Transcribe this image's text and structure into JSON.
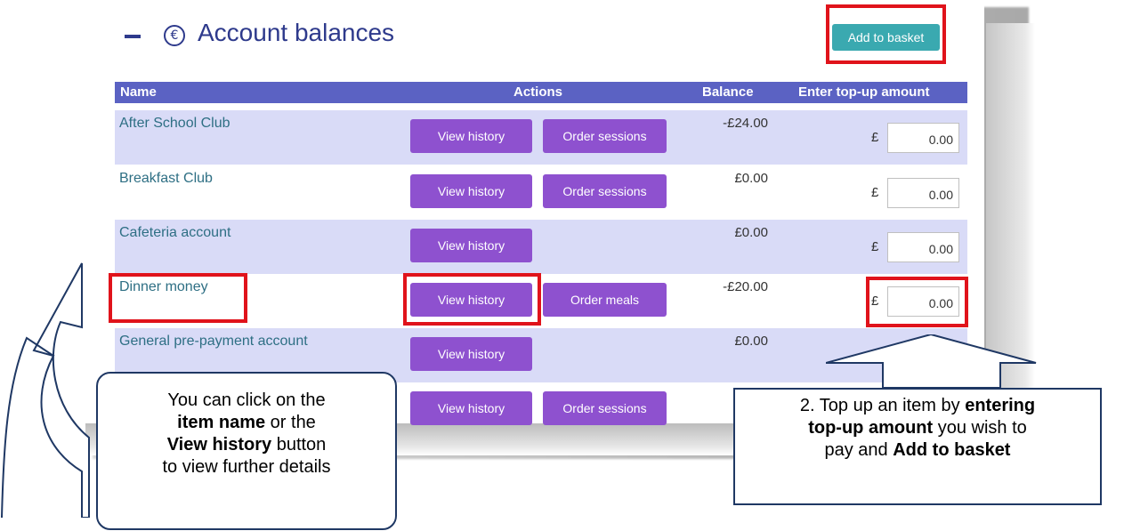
{
  "header": {
    "title": "Account balances",
    "collapse_icon": "minus-icon",
    "currency_icon": "euro-icon",
    "add_to_basket_label": "Add to basket"
  },
  "table": {
    "columns": [
      "Name",
      "Actions",
      "Balance",
      "Enter top-up amount"
    ],
    "currency_symbol": "£",
    "rows": [
      {
        "name": "After School Club",
        "history_label": "View history",
        "second_label": "Order sessions",
        "balance": "-£24.00",
        "amount": "0.00"
      },
      {
        "name": "Breakfast Club",
        "history_label": "View history",
        "second_label": "Order sessions",
        "balance": "£0.00",
        "amount": "0.00"
      },
      {
        "name": "Cafeteria account",
        "history_label": "View history",
        "second_label": "",
        "balance": "£0.00",
        "amount": "0.00"
      },
      {
        "name": "Dinner money",
        "history_label": "View history",
        "second_label": "Order meals",
        "balance": "-£20.00",
        "amount": "0.00"
      },
      {
        "name": "General pre-payment account",
        "history_label": "View history",
        "second_label": "",
        "balance": "£0.00",
        "amount": ""
      },
      {
        "name": "",
        "history_label": "View history",
        "second_label": "Order sessions",
        "balance": "£",
        "amount": ""
      }
    ]
  },
  "callouts": {
    "left": {
      "line1": "You can click on the",
      "bold1": "item name",
      "line2_suffix": " or the",
      "bold2": "View history",
      "line3_suffix": " button",
      "line4": "to view further details"
    },
    "right": {
      "line1_prefix": "2. Top up an item by ",
      "bold1": "entering",
      "bold2": "top-up amount",
      "line2_suffix": " you wish to",
      "line3_prefix": "pay and ",
      "bold3": "Add to basket"
    }
  },
  "colors": {
    "title": "#2e3a8c",
    "header_bg": "#5b62c3",
    "row_shade": "#d9dbf7",
    "button_purple": "#8e51cf",
    "button_teal": "#3aa9b0",
    "highlight_red": "#e0131b",
    "callout_border": "#1f3864"
  }
}
